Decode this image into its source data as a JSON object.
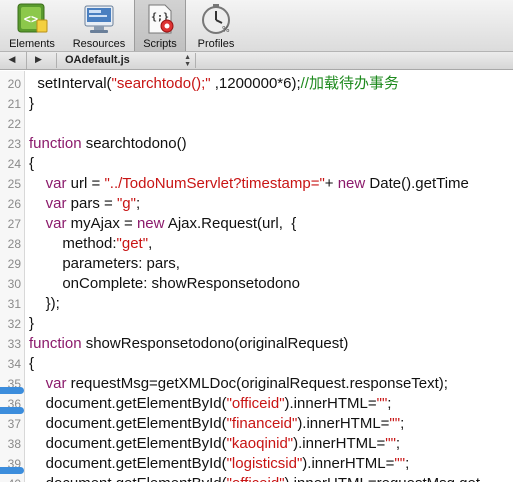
{
  "toolbar": {
    "items": [
      {
        "label": "Elements",
        "icon": "elements-icon",
        "selected": false
      },
      {
        "label": "Resources",
        "icon": "resources-icon",
        "selected": false
      },
      {
        "label": "Scripts",
        "icon": "scripts-icon",
        "selected": true
      },
      {
        "label": "Profiles",
        "icon": "profiles-icon",
        "selected": false
      }
    ]
  },
  "filebar": {
    "back_glyph": "◀",
    "forward_glyph": "▶",
    "file_name": "OAdefault.js"
  },
  "editor": {
    "lines": [
      {
        "num": "20",
        "tokens": [
          [
            "id",
            "  setInterval("
          ],
          [
            "str",
            "\"searchtodo();\""
          ],
          [
            "id",
            " ,1200000*6);"
          ],
          [
            "cmt",
            "//加载待办事务"
          ]
        ]
      },
      {
        "num": "21",
        "tokens": [
          [
            "id",
            "}"
          ]
        ]
      },
      {
        "num": "22",
        "tokens": []
      },
      {
        "num": "23",
        "tokens": [
          [
            "kw",
            "function"
          ],
          [
            "id",
            " searchtodono()"
          ]
        ]
      },
      {
        "num": "24",
        "tokens": [
          [
            "id",
            "{"
          ]
        ]
      },
      {
        "num": "25",
        "tokens": [
          [
            "id",
            "    "
          ],
          [
            "kw",
            "var"
          ],
          [
            "id",
            " url = "
          ],
          [
            "str",
            "\"../TodoNumServlet?timestamp=\""
          ],
          [
            "id",
            "+ "
          ],
          [
            "kw",
            "new"
          ],
          [
            "id",
            " Date().getTime"
          ]
        ]
      },
      {
        "num": "26",
        "tokens": [
          [
            "id",
            "    "
          ],
          [
            "kw",
            "var"
          ],
          [
            "id",
            " pars = "
          ],
          [
            "str",
            "\"g\""
          ],
          [
            "id",
            ";"
          ]
        ]
      },
      {
        "num": "27",
        "tokens": [
          [
            "id",
            "    "
          ],
          [
            "kw",
            "var"
          ],
          [
            "id",
            " myAjax = "
          ],
          [
            "kw",
            "new"
          ],
          [
            "id",
            " Ajax.Request(url,  {"
          ]
        ]
      },
      {
        "num": "28",
        "tokens": [
          [
            "id",
            "        method:"
          ],
          [
            "str",
            "\"get\""
          ],
          [
            "id",
            ","
          ]
        ]
      },
      {
        "num": "29",
        "tokens": [
          [
            "id",
            "        parameters: pars,"
          ]
        ]
      },
      {
        "num": "30",
        "tokens": [
          [
            "id",
            "        onComplete: showResponsetodono"
          ]
        ]
      },
      {
        "num": "31",
        "tokens": [
          [
            "id",
            "    });"
          ]
        ]
      },
      {
        "num": "32",
        "tokens": [
          [
            "id",
            "}"
          ]
        ]
      },
      {
        "num": "33",
        "tokens": [
          [
            "kw",
            "function"
          ],
          [
            "id",
            " showResponsetodono(originalRequest)"
          ]
        ]
      },
      {
        "num": "34",
        "tokens": [
          [
            "id",
            "{"
          ]
        ]
      },
      {
        "num": "35",
        "bp": true,
        "tokens": [
          [
            "id",
            "    "
          ],
          [
            "kw",
            "var"
          ],
          [
            "id",
            " requestMsg=getXMLDoc(originalRequest.responseText);"
          ]
        ]
      },
      {
        "num": "36",
        "bp": true,
        "tokens": [
          [
            "id",
            "    document.getElementById("
          ],
          [
            "str",
            "\"officeid\""
          ],
          [
            "id",
            ").innerHTML="
          ],
          [
            "str",
            "\"\""
          ],
          [
            "id",
            ";"
          ]
        ]
      },
      {
        "num": "37",
        "tokens": [
          [
            "id",
            "    document.getElementById("
          ],
          [
            "str",
            "\"financeid\""
          ],
          [
            "id",
            ").innerHTML="
          ],
          [
            "str",
            "\"\""
          ],
          [
            "id",
            ";"
          ]
        ]
      },
      {
        "num": "38",
        "tokens": [
          [
            "id",
            "    document.getElementById("
          ],
          [
            "str",
            "\"kaoqinid\""
          ],
          [
            "id",
            ").innerHTML="
          ],
          [
            "str",
            "\"\""
          ],
          [
            "id",
            ";"
          ]
        ]
      },
      {
        "num": "39",
        "bp": true,
        "tokens": [
          [
            "id",
            "    document.getElementById("
          ],
          [
            "str",
            "\"logisticsid\""
          ],
          [
            "id",
            ").innerHTML="
          ],
          [
            "str",
            "\"\""
          ],
          [
            "id",
            ";"
          ]
        ]
      },
      {
        "num": "40",
        "tokens": [
          [
            "id",
            "    document.getElementById("
          ],
          [
            "str",
            "\"officeid\""
          ],
          [
            "id",
            ").innerHTML=requestMsg.get"
          ]
        ]
      }
    ]
  }
}
